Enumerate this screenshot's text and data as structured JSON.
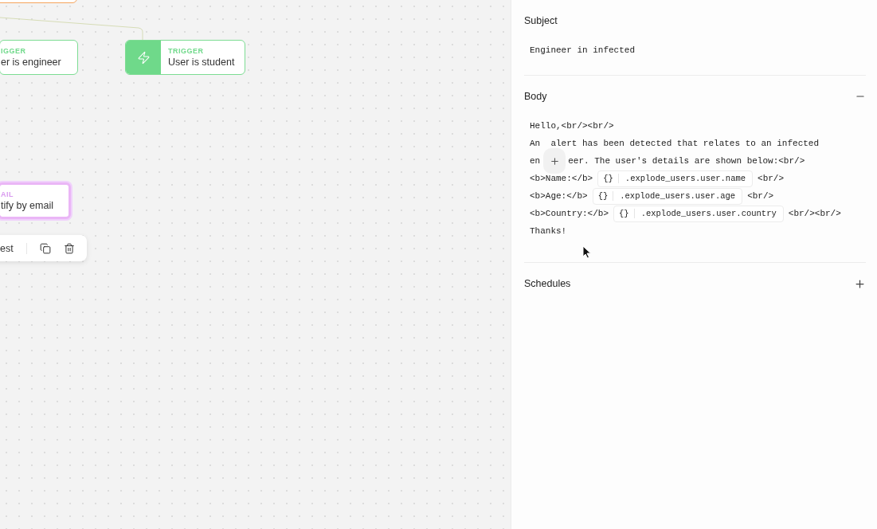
{
  "canvas": {
    "nodes": [
      {
        "kind": "partial"
      },
      {
        "kind": "trigger",
        "label": "IGGER",
        "title": "er is engineer",
        "selected": false
      },
      {
        "kind": "trigger",
        "label": "TRIGGER",
        "title": "User is student",
        "selected": false
      },
      {
        "kind": "email",
        "label": "AIL",
        "title": "tify by email",
        "selected": true
      }
    ],
    "toolbar": {
      "test_label": "est"
    }
  },
  "panel": {
    "subject": {
      "title": "Subject",
      "value": "Engineer in infected"
    },
    "body": {
      "title": "Body",
      "expanded": true,
      "lines": [
        [
          {
            "kind": "text",
            "text": "Hello,<br/><br/>"
          }
        ],
        [
          {
            "kind": "text",
            "text": "An  alert has been detected that relates to an infected"
          }
        ],
        [
          {
            "kind": "text",
            "text": "en"
          },
          {
            "kind": "add"
          },
          {
            "kind": "text",
            "text": "eer. The user's details are shown below:<br/>"
          }
        ],
        [
          {
            "kind": "text",
            "text": "<b>Name:</b>"
          },
          {
            "kind": "var",
            "icon": "{}",
            "path": ".explode_users.user.name"
          },
          {
            "kind": "text",
            "text": "<br/>"
          }
        ],
        [
          {
            "kind": "text",
            "text": "<b>Age:</b>"
          },
          {
            "kind": "var",
            "icon": "{}",
            "path": ".explode_users.user.age"
          },
          {
            "kind": "text",
            "text": "<br/>"
          }
        ],
        [
          {
            "kind": "text",
            "text": "<b>Country:</b>"
          },
          {
            "kind": "var",
            "icon": "{}",
            "path": ".explode_users.user.country"
          },
          {
            "kind": "text",
            "text": "<br/><br/>"
          }
        ],
        [
          {
            "kind": "text",
            "text": "Thanks!"
          }
        ]
      ]
    },
    "schedules": {
      "title": "Schedules",
      "expanded": false
    }
  }
}
